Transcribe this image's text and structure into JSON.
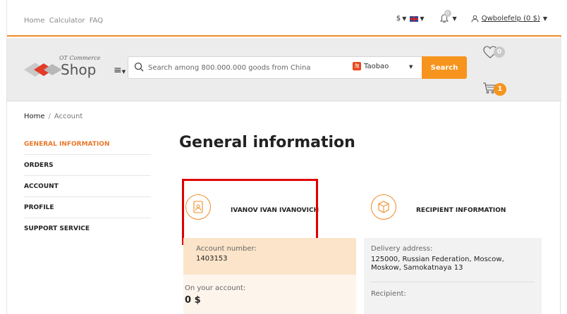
{
  "topbar": {
    "links": [
      "Home",
      "Calculator",
      "FAQ"
    ],
    "currency": "$",
    "notifications_count": "0",
    "user_label": "Qwbolefelp (0 $)"
  },
  "header": {
    "logo_top": "OT Commerce",
    "logo_main": "Shop",
    "search_placeholder": "Search among 800.000.000 goods from China",
    "provider": "Taobao",
    "search_button": "Search",
    "favorites_count": "0",
    "cart_count": "1"
  },
  "breadcrumb": {
    "home": "Home",
    "separator": "/",
    "current": "Account"
  },
  "sidebar": {
    "items": [
      {
        "label": "GENERAL INFORMATION",
        "active": true
      },
      {
        "label": "ORDERS",
        "active": false
      },
      {
        "label": "ACCOUNT",
        "active": false
      },
      {
        "label": "PROFILE",
        "active": false
      },
      {
        "label": "SUPPORT SERVICE",
        "active": false
      }
    ]
  },
  "main": {
    "title": "General information",
    "user_card": {
      "name": "IVANOV IVAN IVANOVICH",
      "account_number_label": "Account number:",
      "account_number": "1403153",
      "balance_label": "On your account:",
      "balance": "0 $"
    },
    "recipient_card": {
      "title": "RECIPIENT INFORMATION",
      "delivery_label": "Delivery address:",
      "delivery_line1": "125000, Russian Federation, Moscow,",
      "delivery_line2": "Moskow, Samokatnaya 13",
      "recipient_label": "Recipient:"
    }
  },
  "colors": {
    "accent": "#f7941d",
    "highlight": "#e00000",
    "active_nav": "#e8772a"
  },
  "icons": {
    "search": "search-icon",
    "favorites": "heart-icon",
    "cart": "cart-icon",
    "bell": "bell-icon",
    "user": "user-icon",
    "user_card": "user-document-icon",
    "recipient": "package-icon"
  }
}
